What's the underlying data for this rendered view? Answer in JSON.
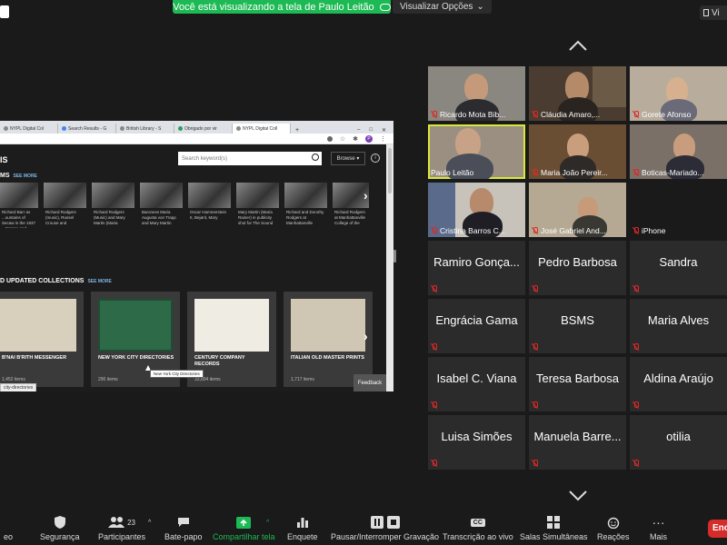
{
  "top": {
    "share_banner": "Você está visualizando a tela de Paulo Leitão",
    "view_options": "Visualizar Opções",
    "view_button": "Vi"
  },
  "browser": {
    "tabs": [
      {
        "label": "NYPL Digital Col"
      },
      {
        "label": "Search Results - G"
      },
      {
        "label": "British Library - S"
      },
      {
        "label": "Obrigado por vir"
      },
      {
        "label": "NYPL Digital Coll",
        "active": true
      }
    ],
    "add_tab": "+",
    "window_controls": [
      "–",
      "□",
      "✕"
    ],
    "profile_initial": "P",
    "page": {
      "title_fragment": "IS",
      "search_placeholder": "Search keyword(s)",
      "browse_label": "Browse",
      "info_label": "i",
      "section1_fragment": "MS",
      "see_more": "SEE MORE",
      "photos": [
        "Richard Barr as ...ountains of Secaw in the 1937 ...Cronse and",
        "Richard Rodgers (music), Russel Crouse and",
        "Richard Rodgers (Music) and Mary Martin (Maria",
        "Baroness Maria Augusta von Trapp and Mary Martin",
        "Oscar Hammerstein II, Bejørit, Mary",
        "Mary Martin (Maria Rainer) in publicity shot for The Sound",
        "Richard and Dorothy Rodgers at Manhattanville",
        "Richard Rodgers at Manhattanville College of the"
      ],
      "section2_fragment": "D UPDATED COLLECTIONS",
      "collections": [
        {
          "title": "B'NAI B'RITH MESSENGER",
          "count": "1,452 items"
        },
        {
          "title": "NEW YORK CITY DIRECTORIES",
          "count": "290 items"
        },
        {
          "title": "CENTURY COMPANY RECORDS",
          "count": "33,894 items"
        },
        {
          "title": "ITALIAN OLD MASTER PRINTS",
          "count": "1,717 items"
        }
      ],
      "tooltip": "New York City Directories",
      "feedback": "Feedback",
      "status_url": "city-directories"
    }
  },
  "participants": [
    {
      "name": "Ricardo Mota Bib...",
      "video": true,
      "muted": true
    },
    {
      "name": "Cláudia Amaro,...",
      "video": true,
      "muted": true
    },
    {
      "name": "Gorete Afonso",
      "video": true,
      "muted": true
    },
    {
      "name": "Paulo Leitão",
      "video": true,
      "muted": false,
      "speaking": true
    },
    {
      "name": "Maria João Pereir...",
      "video": true,
      "muted": true
    },
    {
      "name": "Boticas-Mariado...",
      "video": true,
      "muted": true
    },
    {
      "name": "Cristina Barros C...",
      "video": true,
      "muted": true
    },
    {
      "name": "José Gabriel And...",
      "video": true,
      "muted": true
    },
    {
      "name": "iPhone",
      "video": false,
      "muted": true,
      "small_name": true
    },
    {
      "name": "Ramiro Gonça...",
      "video": false,
      "muted": true
    },
    {
      "name": "Pedro Barbosa",
      "video": false,
      "muted": true
    },
    {
      "name": "Sandra",
      "video": false,
      "muted": true
    },
    {
      "name": "Engrácia Gama",
      "video": false,
      "muted": true
    },
    {
      "name": "BSMS",
      "video": false,
      "muted": true
    },
    {
      "name": "Maria Alves",
      "video": false,
      "muted": true
    },
    {
      "name": "Isabel C. Viana",
      "video": false,
      "muted": true
    },
    {
      "name": "Teresa Barbosa",
      "video": false,
      "muted": true
    },
    {
      "name": "Aldina Araújo",
      "video": false,
      "muted": true
    },
    {
      "name": "Luisa Simões",
      "video": false,
      "muted": true
    },
    {
      "name": "Manuela Barre...",
      "video": false,
      "muted": true
    },
    {
      "name": "otilia",
      "video": false,
      "muted": true
    }
  ],
  "toolbar": {
    "video_fragment": "eo",
    "security": "Segurança",
    "participants": "Participantes",
    "participants_count": "23",
    "chat": "Bate-papo",
    "share": "Compartilhar tela",
    "poll": "Enquete",
    "record": "Pausar/Interromper Gravação",
    "transcript": "Transcrição ao vivo",
    "cc": "CC",
    "breakout": "Salas Simultâneas",
    "reactions": "Reações",
    "more": "Mais",
    "end": "Enc"
  },
  "colors": {
    "share_green": "#1db954",
    "active_speaker": "#d8e83a",
    "mute_red": "#e02828",
    "end_red": "#d62b2b"
  }
}
